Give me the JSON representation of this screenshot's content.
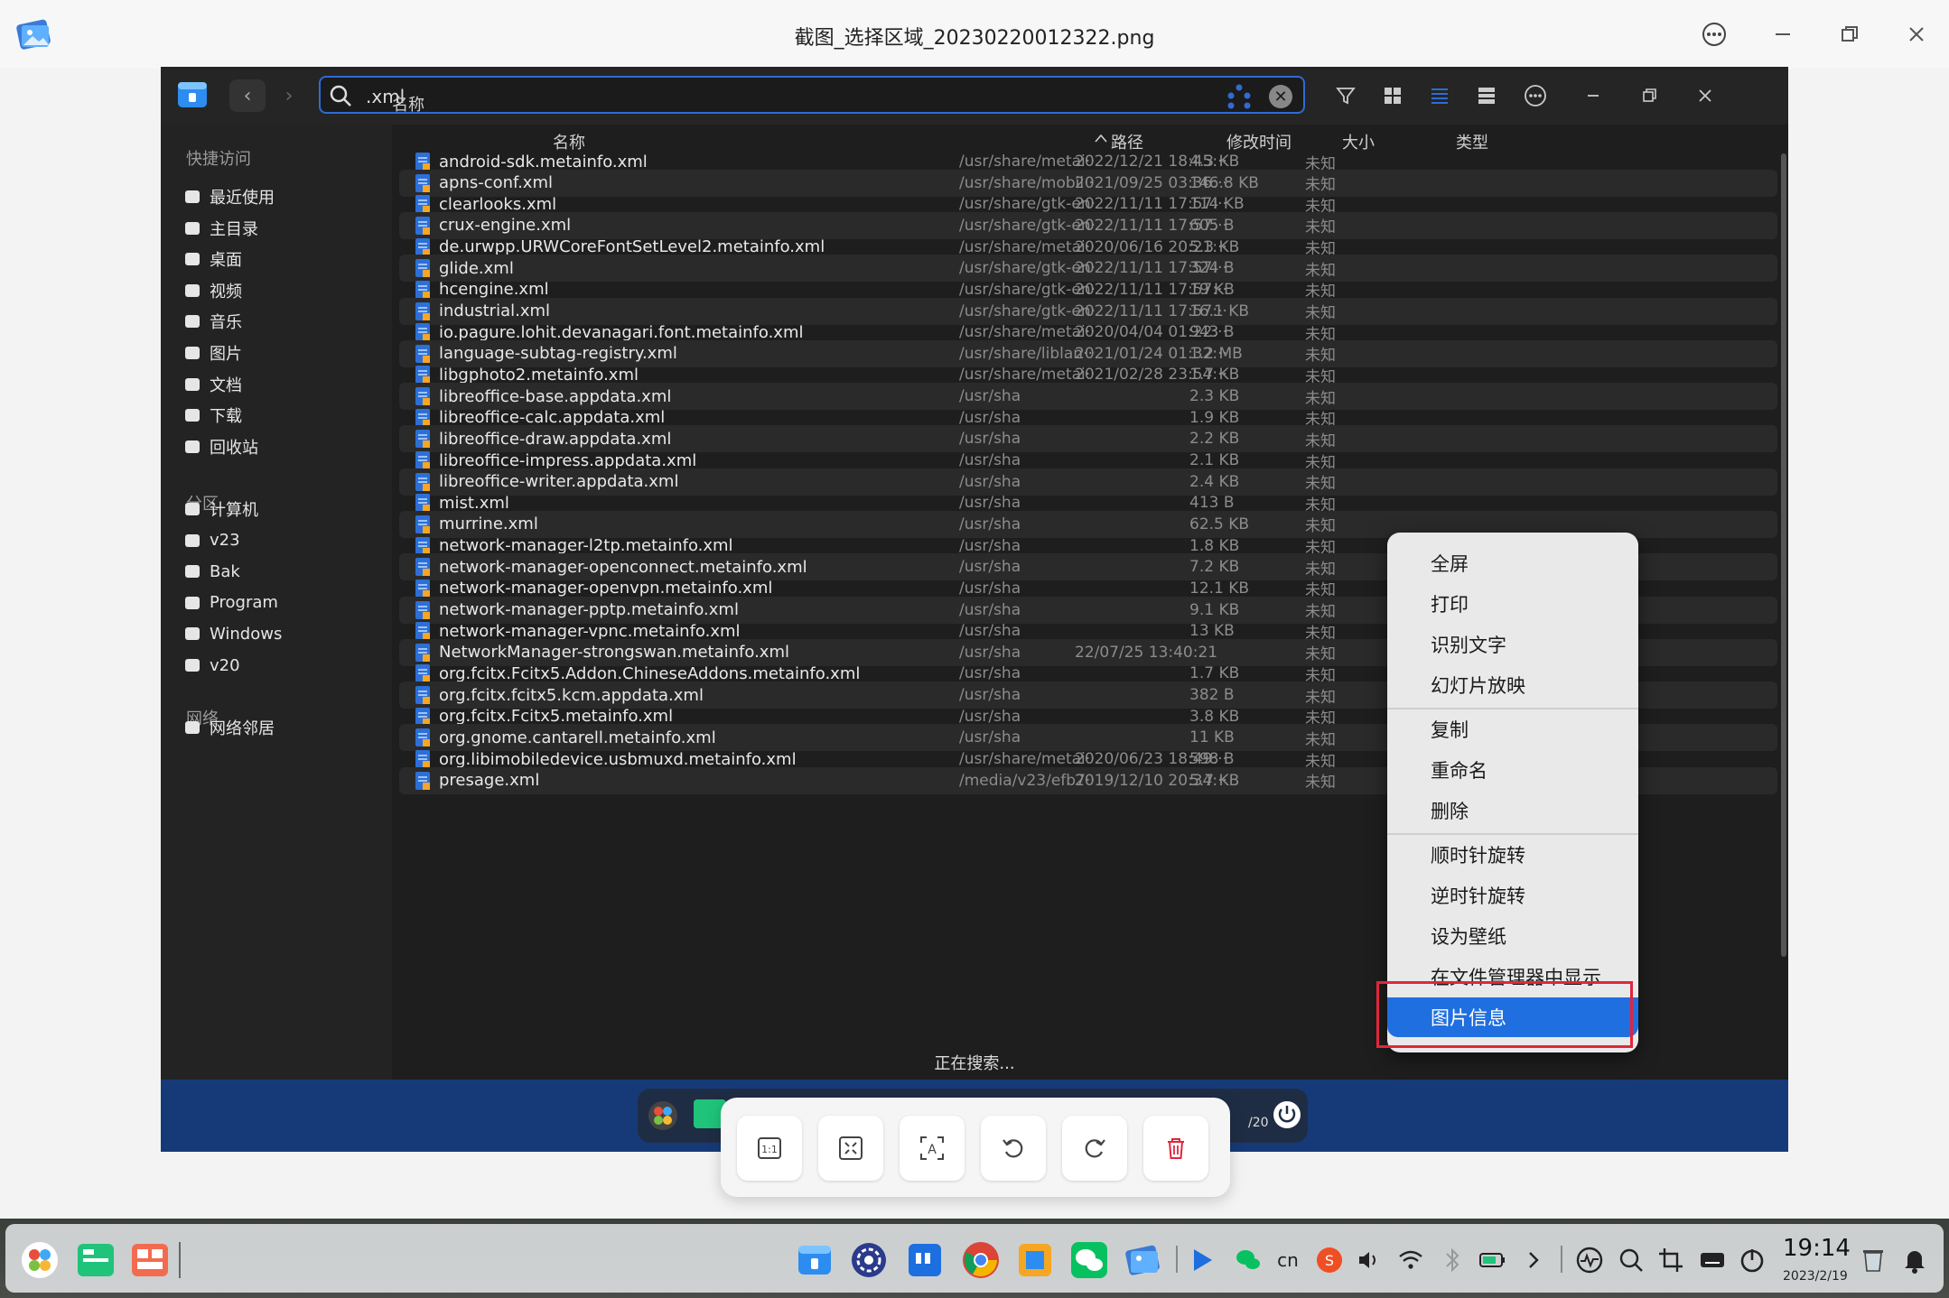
{
  "viewer": {
    "title": "截图_选择区域_20230220012322.png",
    "icons": {
      "app": "image-viewer-icon",
      "menu": "more-icon",
      "minimize": "minimize-icon",
      "restore": "restore-icon",
      "close": "close-icon"
    }
  },
  "file_manager": {
    "search": {
      "value": ".xml"
    },
    "sidebar": {
      "quick_access_label": "快捷访问",
      "quick_access": [
        "最近使用",
        "主目录",
        "桌面",
        "视频",
        "音乐",
        "图片",
        "文档",
        "下载",
        "回收站"
      ],
      "partition_label": "分区",
      "partitions": [
        "计算机",
        "v23",
        "Bak",
        "Program",
        "Windows",
        "v20"
      ],
      "network_label": "网络",
      "network": [
        "网络邻居"
      ]
    },
    "columns": {
      "name": "名称",
      "path": "路径",
      "modified": "修改时间",
      "size": "大小",
      "type": "类型"
    },
    "rows": [
      {
        "name": "android-sdk.metainfo.xml",
        "path": "/usr/share/metai···",
        "modified": "2022/12/21 18:45:···",
        "size": "4.3 KB",
        "type": "未知"
      },
      {
        "name": "apns-conf.xml",
        "path": "/usr/share/mobil···",
        "modified": "2021/09/25 03:36:···",
        "size": "146.8 KB",
        "type": "未知"
      },
      {
        "name": "clearlooks.xml",
        "path": "/usr/share/gtk-en···",
        "modified": "2022/11/11 17:57:···",
        "size": "114 KB",
        "type": "未知"
      },
      {
        "name": "crux-engine.xml",
        "path": "/usr/share/gtk-en···",
        "modified": "2022/11/11 17:57:···",
        "size": "605 B",
        "type": "未知"
      },
      {
        "name": "de.urwpp.URWCoreFontSetLevel2.metainfo.xml",
        "path": "/usr/share/metai···",
        "modified": "2020/06/16 20:21:···",
        "size": "5.3 KB",
        "type": "未知"
      },
      {
        "name": "glide.xml",
        "path": "/usr/share/gtk-en···",
        "modified": "2022/11/11 17:57:···",
        "size": "324 B",
        "type": "未知"
      },
      {
        "name": "hcengine.xml",
        "path": "/usr/share/gtk-en···",
        "modified": "2022/11/11 17:57:···",
        "size": "19 KB",
        "type": "未知"
      },
      {
        "name": "industrial.xml",
        "path": "/usr/share/gtk-en···",
        "modified": "2022/11/11 17:57:···",
        "size": "16.1 KB",
        "type": "未知"
      },
      {
        "name": "io.pagure.lohit.devanagari.font.metainfo.xml",
        "path": "/usr/share/metai···",
        "modified": "2020/04/04 01:22:···",
        "size": "943 B",
        "type": "未知"
      },
      {
        "name": "language-subtag-registry.xml",
        "path": "/usr/share/liblan···",
        "modified": "2021/01/24 01:32:···",
        "size": "1.2 MB",
        "type": "未知"
      },
      {
        "name": "libgphoto2.metainfo.xml",
        "path": "/usr/share/metai···",
        "modified": "2021/02/28 23:54:···",
        "size": "1.7 KB",
        "type": "未知"
      },
      {
        "name": "libreoffice-base.appdata.xml",
        "path": "/usr/sha",
        "modified": "",
        "size": "2.3 KB",
        "type": "未知"
      },
      {
        "name": "libreoffice-calc.appdata.xml",
        "path": "/usr/sha",
        "modified": "",
        "size": "1.9 KB",
        "type": "未知"
      },
      {
        "name": "libreoffice-draw.appdata.xml",
        "path": "/usr/sha",
        "modified": "",
        "size": "2.2 KB",
        "type": "未知"
      },
      {
        "name": "libreoffice-impress.appdata.xml",
        "path": "/usr/sha",
        "modified": "",
        "size": "2.1 KB",
        "type": "未知"
      },
      {
        "name": "libreoffice-writer.appdata.xml",
        "path": "/usr/sha",
        "modified": "",
        "size": "2.4 KB",
        "type": "未知"
      },
      {
        "name": "mist.xml",
        "path": "/usr/sha",
        "modified": "",
        "size": "413 B",
        "type": "未知"
      },
      {
        "name": "murrine.xml",
        "path": "/usr/sha",
        "modified": "",
        "size": "62.5 KB",
        "type": "未知"
      },
      {
        "name": "network-manager-l2tp.metainfo.xml",
        "path": "/usr/sha",
        "modified": "",
        "size": "1.8 KB",
        "type": "未知"
      },
      {
        "name": "network-manager-openconnect.metainfo.xml",
        "path": "/usr/sha",
        "modified": "",
        "size": "7.2 KB",
        "type": "未知"
      },
      {
        "name": "network-manager-openvpn.metainfo.xml",
        "path": "/usr/sha",
        "modified": "",
        "size": "12.1 KB",
        "type": "未知"
      },
      {
        "name": "network-manager-pptp.metainfo.xml",
        "path": "/usr/sha",
        "modified": "",
        "size": "9.1 KB",
        "type": "未知"
      },
      {
        "name": "network-manager-vpnc.metainfo.xml",
        "path": "/usr/sha",
        "modified": "",
        "size": "13 KB",
        "type": "未知"
      },
      {
        "name": "NetworkManager-strongswan.metainfo.xml",
        "path": "/usr/sha",
        "modified": "22/07/25 13:40:21",
        "size": "",
        "type": "未知"
      },
      {
        "name": "org.fcitx.Fcitx5.Addon.ChineseAddons.metainfo.xml",
        "path": "/usr/sha",
        "modified": "",
        "size": "1.7 KB",
        "type": "未知"
      },
      {
        "name": "org.fcitx.fcitx5.kcm.appdata.xml",
        "path": "/usr/sha",
        "modified": "",
        "size": "382 B",
        "type": "未知"
      },
      {
        "name": "org.fcitx.Fcitx5.metainfo.xml",
        "path": "/usr/sha",
        "modified": "",
        "size": "3.8 KB",
        "type": "未知"
      },
      {
        "name": "org.gnome.cantarell.metainfo.xml",
        "path": "/usr/sha",
        "modified": "",
        "size": "11 KB",
        "type": "未知"
      },
      {
        "name": "org.libimobiledevice.usbmuxd.metainfo.xml",
        "path": "/usr/share/metai···",
        "modified": "2020/06/23 18:49:···",
        "size": "598 B",
        "type": "未知"
      },
      {
        "name": "presage.xml",
        "path": "/media/v23/efb7···",
        "modified": "2019/12/10 20:34:···",
        "size": "5.7 KB",
        "type": "未知"
      }
    ],
    "status": "正在搜索...",
    "dock_page": "/20"
  },
  "context_menu": {
    "groups": [
      [
        "全屏",
        "打印",
        "识别文字",
        "幻灯片放映"
      ],
      [
        "复制",
        "重命名",
        "删除"
      ],
      [
        "顺时针旋转",
        "逆时针旋转",
        "设为壁纸",
        "在文件管理器中显示",
        "图片信息"
      ]
    ],
    "active": "图片信息"
  },
  "viewer_toolbar": [
    "original-size-icon",
    "fit-window-icon",
    "ocr-icon",
    "rotate-left-icon",
    "rotate-right-icon",
    "delete-icon"
  ],
  "taskbar": {
    "input_method": "cn",
    "time": "19:14",
    "date": "2023/2/19"
  }
}
